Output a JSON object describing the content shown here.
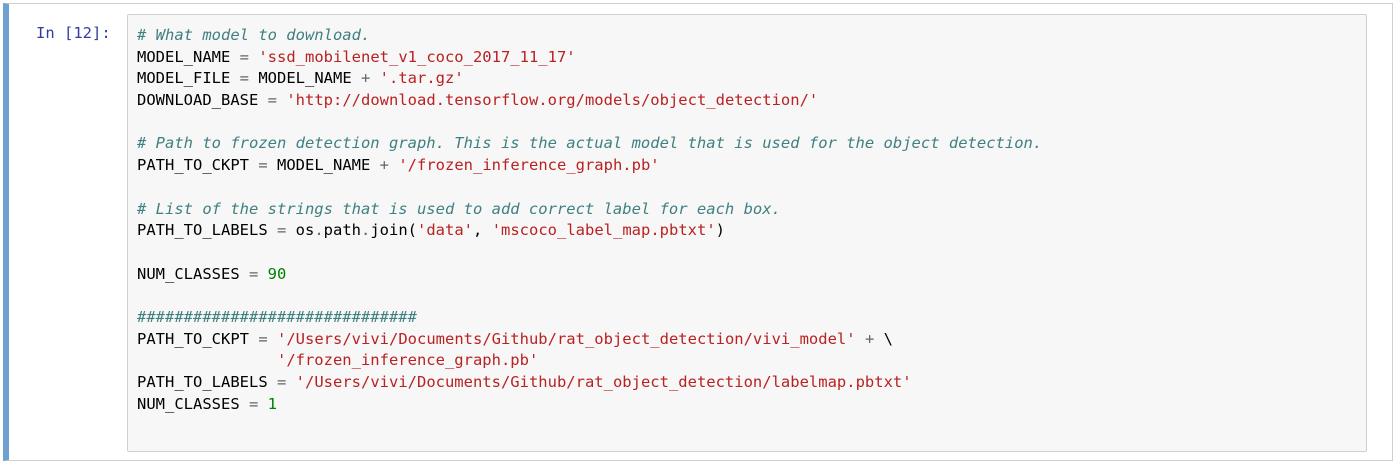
{
  "cell": {
    "prompt": "In [12]:",
    "lines": [
      [
        {
          "t": "# What model to download.",
          "k": "comment"
        }
      ],
      [
        {
          "t": "MODEL_NAME ",
          "k": "name"
        },
        {
          "t": "=",
          "k": "op"
        },
        {
          "t": " ",
          "k": "name"
        },
        {
          "t": "'ssd_mobilenet_v1_coco_2017_11_17'",
          "k": "string"
        }
      ],
      [
        {
          "t": "MODEL_FILE ",
          "k": "name"
        },
        {
          "t": "=",
          "k": "op"
        },
        {
          "t": " MODEL_NAME ",
          "k": "name"
        },
        {
          "t": "+",
          "k": "op"
        },
        {
          "t": " ",
          "k": "name"
        },
        {
          "t": "'.tar.gz'",
          "k": "string"
        }
      ],
      [
        {
          "t": "DOWNLOAD_BASE ",
          "k": "name"
        },
        {
          "t": "=",
          "k": "op"
        },
        {
          "t": " ",
          "k": "name"
        },
        {
          "t": "'http://download.tensorflow.org/models/object_detection/'",
          "k": "string"
        }
      ],
      [],
      [
        {
          "t": "# Path to frozen detection graph. This is the actual model that is used for the object detection.",
          "k": "comment"
        }
      ],
      [
        {
          "t": "PATH_TO_CKPT ",
          "k": "name"
        },
        {
          "t": "=",
          "k": "op"
        },
        {
          "t": " MODEL_NAME ",
          "k": "name"
        },
        {
          "t": "+",
          "k": "op"
        },
        {
          "t": " ",
          "k": "name"
        },
        {
          "t": "'/frozen_inference_graph.pb'",
          "k": "string"
        }
      ],
      [],
      [
        {
          "t": "# List of the strings that is used to add correct label for each box.",
          "k": "comment"
        }
      ],
      [
        {
          "t": "PATH_TO_LABELS ",
          "k": "name"
        },
        {
          "t": "=",
          "k": "op"
        },
        {
          "t": " os",
          "k": "name"
        },
        {
          "t": ".",
          "k": "op"
        },
        {
          "t": "path",
          "k": "name"
        },
        {
          "t": ".",
          "k": "op"
        },
        {
          "t": "join(",
          "k": "name"
        },
        {
          "t": "'data'",
          "k": "string"
        },
        {
          "t": ", ",
          "k": "name"
        },
        {
          "t": "'mscoco_label_map.pbtxt'",
          "k": "string"
        },
        {
          "t": ")",
          "k": "name"
        }
      ],
      [],
      [
        {
          "t": "NUM_CLASSES ",
          "k": "name"
        },
        {
          "t": "=",
          "k": "op"
        },
        {
          "t": " ",
          "k": "name"
        },
        {
          "t": "90",
          "k": "number"
        }
      ],
      [],
      [
        {
          "t": "##############################",
          "k": "comment"
        }
      ],
      [
        {
          "t": "PATH_TO_CKPT ",
          "k": "name"
        },
        {
          "t": "=",
          "k": "op"
        },
        {
          "t": " ",
          "k": "name"
        },
        {
          "t": "'/Users/vivi/Documents/Github/rat_object_detection/vivi_model'",
          "k": "string"
        },
        {
          "t": " ",
          "k": "name"
        },
        {
          "t": "+",
          "k": "op"
        },
        {
          "t": " \\",
          "k": "name"
        }
      ],
      [
        {
          "t": "               ",
          "k": "name"
        },
        {
          "t": "'/frozen_inference_graph.pb'",
          "k": "string"
        }
      ],
      [
        {
          "t": "PATH_TO_LABELS ",
          "k": "name"
        },
        {
          "t": "=",
          "k": "op"
        },
        {
          "t": " ",
          "k": "name"
        },
        {
          "t": "'/Users/vivi/Documents/Github/rat_object_detection/labelmap.pbtxt'",
          "k": "string"
        }
      ],
      [
        {
          "t": "NUM_CLASSES ",
          "k": "name"
        },
        {
          "t": "=",
          "k": "op"
        },
        {
          "t": " ",
          "k": "name"
        },
        {
          "t": "1",
          "k": "number"
        }
      ]
    ]
  },
  "colors": {
    "prompt": "#303f9f",
    "cell_border_left": "#6fa1d0",
    "input_background": "#f7f7f7",
    "comment": "#408080",
    "string": "#ba2121",
    "operator": "#666666",
    "number": "#008000"
  }
}
